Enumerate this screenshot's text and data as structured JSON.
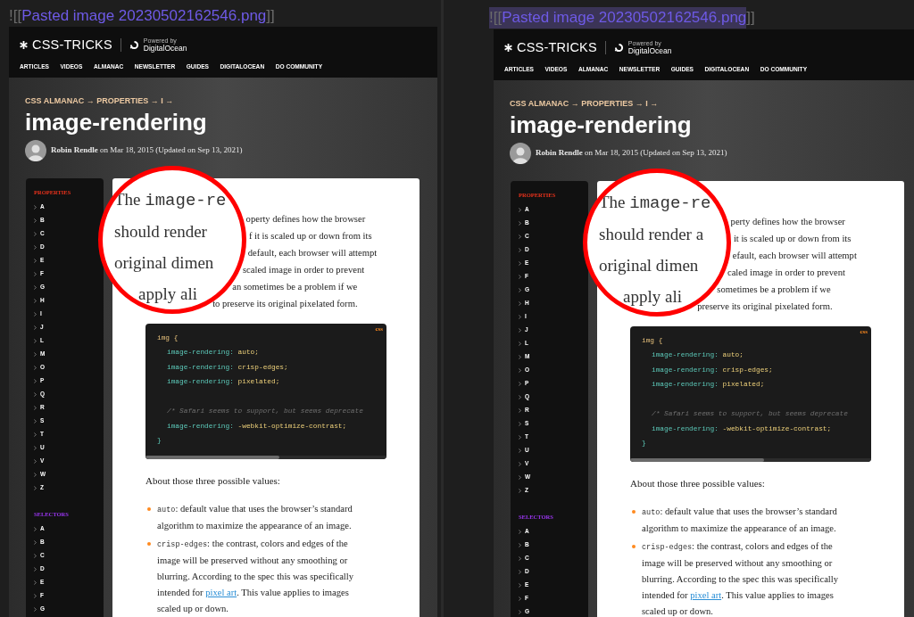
{
  "panes": [
    {
      "link": {
        "prefix": "![[",
        "target": "Pasted image 20230502162546.png",
        "suffix": "]]",
        "selected": false
      },
      "screenshot": {
        "logo": "CSS-TRICKS",
        "sponsor_note": "Powered by",
        "sponsor": "DigitalOcean",
        "nav": [
          "ARTICLES",
          "VIDEOS",
          "ALMANAC",
          "NEWSLETTER",
          "GUIDES",
          "DIGITALOCEAN",
          "DO COMMUNITY"
        ],
        "breadcrumb": "CSS ALMANAC → PROPERTIES → I →",
        "title": "image-rendering",
        "byline": "**Robin Rendle** on Mar 18, 2015 (Updated on Sep 13, 2021)",
        "sidebar": [
          {
            "heading": "PROPERTIES",
            "color": "#e8321c",
            "items": [
              "A",
              "B",
              "C",
              "D",
              "E",
              "F",
              "G",
              "H",
              "I",
              "J",
              "L",
              "M",
              "O",
              "P",
              "Q",
              "R",
              "S",
              "T",
              "U",
              "V",
              "W",
              "Z"
            ]
          },
          {
            "heading": "SELECTORS",
            "color": "#9a35f0",
            "items": [
              "A",
              "B",
              "C",
              "D",
              "E",
              "F",
              "G"
            ]
          }
        ],
        "magnifier": [
          [
            {
              "kind": "text",
              "text": "The "
            },
            {
              "kind": "code",
              "text": "image-re"
            }
          ],
          [
            {
              "kind": "text",
              "text": "should render"
            }
          ],
          [
            {
              "kind": "text",
              "text": "original dimen"
            }
          ],
          [
            {
              "kind": "text",
              "text": "apply ali"
            }
          ]
        ],
        "intro_lines": [
          "operty defines how the browser",
          "f it is scaled up or down from its",
          "default, each browser will attempt",
          "scaled image in order to prevent",
          "an sometimes be a problem if we",
          "to preserve its original pixelated form."
        ],
        "code": {
          "language": "css",
          "lines": [
            {
              "indent": false,
              "gap_before": false,
              "parts": [
                {
                  "kind": "selector",
                  "text": "img {"
                }
              ]
            },
            {
              "indent": true,
              "gap_before": false,
              "parts": [
                {
                  "kind": "property",
                  "text": "image-rendering:"
                },
                {
                  "kind": "value",
                  "text": " auto;"
                }
              ]
            },
            {
              "indent": true,
              "gap_before": false,
              "parts": [
                {
                  "kind": "property",
                  "text": "image-rendering:"
                },
                {
                  "kind": "value",
                  "text": " crisp-edges;"
                }
              ]
            },
            {
              "indent": true,
              "gap_before": false,
              "parts": [
                {
                  "kind": "property",
                  "text": "image-rendering:"
                },
                {
                  "kind": "value",
                  "text": " pixelated;"
                }
              ]
            },
            {
              "indent": true,
              "gap_before": true,
              "parts": [
                {
                  "kind": "comment",
                  "text": "/* Safari seems to support, but seems deprecate"
                }
              ]
            },
            {
              "indent": true,
              "gap_before": false,
              "parts": [
                {
                  "kind": "property",
                  "text": "image-rendering:"
                },
                {
                  "kind": "value",
                  "text": " -webkit-optimize-contrast;"
                }
              ]
            },
            {
              "indent": false,
              "gap_before": false,
              "parts": [
                {
                  "kind": "brace",
                  "text": "}"
                }
              ]
            }
          ]
        },
        "subheading": "About those three possible values:",
        "bullets": [
          [
            {
              "kind": "code",
              "text": "auto"
            },
            {
              "kind": "text",
              "text": ": default value that uses the browser’s standard algorithm to maximize the appearance of an image."
            }
          ],
          [
            {
              "kind": "code",
              "text": "crisp-edges"
            },
            {
              "kind": "text",
              "text": ": the contrast, colors and edges of the image will be preserved without any smoothing or blurring. According to the spec this was specifically intended for "
            },
            {
              "kind": "link",
              "text": "pixel art"
            },
            {
              "kind": "text",
              "text": ". This value applies to images scaled up or down."
            }
          ]
        ]
      }
    },
    {
      "link": {
        "prefix": "![[",
        "target": "Pasted image 20230502162546.png",
        "suffix": "]]",
        "selected": true
      },
      "screenshot": {
        "logo": "CSS-TRICKS",
        "sponsor_note": "Powered by",
        "sponsor": "DigitalOcean",
        "nav": [
          "ARTICLES",
          "VIDEOS",
          "ALMANAC",
          "NEWSLETTER",
          "GUIDES",
          "DIGITALOCEAN",
          "DO COMMUNITY"
        ],
        "breadcrumb": "CSS ALMANAC → PROPERTIES → I →",
        "title": "image-rendering",
        "byline": "**Robin Rendle** on Mar 18, 2015 (Updated on Sep 13, 2021)",
        "sidebar": [
          {
            "heading": "PROPERTIES",
            "color": "#e8321c",
            "items": [
              "A",
              "B",
              "C",
              "D",
              "E",
              "F",
              "G",
              "H",
              "I",
              "J",
              "L",
              "M",
              "O",
              "P",
              "Q",
              "R",
              "S",
              "T",
              "U",
              "V",
              "W",
              "Z"
            ]
          },
          {
            "heading": "SELECTORS",
            "color": "#9a35f0",
            "items": [
              "A",
              "B",
              "C",
              "D",
              "E",
              "F",
              "G"
            ]
          }
        ],
        "magnifier": [
          [
            {
              "kind": "text",
              "text": "The "
            },
            {
              "kind": "code",
              "text": "image-re"
            }
          ],
          [
            {
              "kind": "text",
              "text": "should render a"
            }
          ],
          [
            {
              "kind": "text",
              "text": "original dimen"
            }
          ],
          [
            {
              "kind": "text",
              "text": "apply ali"
            }
          ]
        ],
        "intro_lines": [
          "perty defines how the browser",
          "it is scaled up or down from its",
          "efault, each browser will attempt",
          "caled image in order to prevent",
          "sometimes be a problem if we",
          "preserve its original pixelated form."
        ],
        "code": {
          "language": "css",
          "lines": [
            {
              "indent": false,
              "gap_before": false,
              "parts": [
                {
                  "kind": "selector",
                  "text": "img {"
                }
              ]
            },
            {
              "indent": true,
              "gap_before": false,
              "parts": [
                {
                  "kind": "property",
                  "text": "image-rendering:"
                },
                {
                  "kind": "value",
                  "text": " auto;"
                }
              ]
            },
            {
              "indent": true,
              "gap_before": false,
              "parts": [
                {
                  "kind": "property",
                  "text": "image-rendering:"
                },
                {
                  "kind": "value",
                  "text": " crisp-edges;"
                }
              ]
            },
            {
              "indent": true,
              "gap_before": false,
              "parts": [
                {
                  "kind": "property",
                  "text": "image-rendering:"
                },
                {
                  "kind": "value",
                  "text": " pixelated;"
                }
              ]
            },
            {
              "indent": true,
              "gap_before": true,
              "parts": [
                {
                  "kind": "comment",
                  "text": "/* Safari seems to support, but seems deprecate"
                }
              ]
            },
            {
              "indent": true,
              "gap_before": false,
              "parts": [
                {
                  "kind": "property",
                  "text": "image-rendering:"
                },
                {
                  "kind": "value",
                  "text": " -webkit-optimize-contrast;"
                }
              ]
            },
            {
              "indent": false,
              "gap_before": false,
              "parts": [
                {
                  "kind": "brace",
                  "text": "}"
                }
              ]
            }
          ]
        },
        "subheading": "About those three possible values:",
        "bullets": [
          [
            {
              "kind": "code",
              "text": "auto"
            },
            {
              "kind": "text",
              "text": ": default value that uses the browser’s standard algorithm to maximize the appearance of an image."
            }
          ],
          [
            {
              "kind": "code",
              "text": "crisp-edges"
            },
            {
              "kind": "text",
              "text": ": the contrast, colors and edges of the image will be preserved without any smoothing or blurring. According to the spec this was specifically intended for "
            },
            {
              "kind": "link",
              "text": "pixel art"
            },
            {
              "kind": "text",
              "text": ". This value applies to images scaled up or down."
            }
          ]
        ]
      }
    }
  ]
}
